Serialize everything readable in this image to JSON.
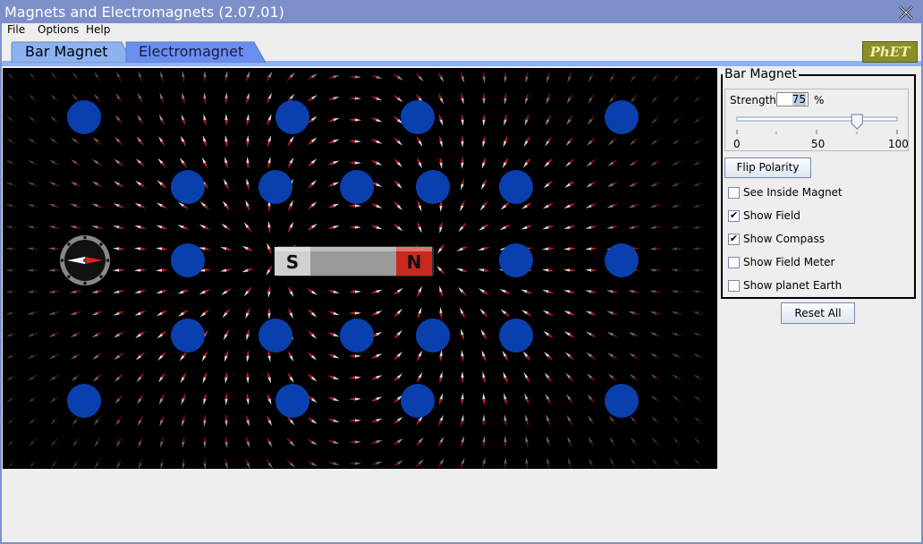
{
  "window": {
    "title": "Magnets and Electromagnets (2.07.01)"
  },
  "menu": {
    "file": "File",
    "options": "Options",
    "help": "Help"
  },
  "tabs": [
    {
      "label": "Bar Magnet",
      "selected": true
    },
    {
      "label": "Electromagnet",
      "selected": false
    }
  ],
  "logo": {
    "text": "PhET"
  },
  "magnet": {
    "south_label": "S",
    "north_label": "N"
  },
  "controls": {
    "panel_title": "Bar Magnet",
    "strength": {
      "label": "Strength:",
      "value": "75",
      "unit": "%",
      "slider_value": 75,
      "min_label": "0",
      "mid_label": "50",
      "max_label": "100"
    },
    "flip_polarity": "Flip Polarity",
    "checkboxes": [
      {
        "label": "See Inside Magnet",
        "checked": false
      },
      {
        "label": "Show Field",
        "checked": true
      },
      {
        "label": "Show Compass",
        "checked": true
      },
      {
        "label": "Show Field Meter",
        "checked": false
      },
      {
        "label": "Show planet Earth",
        "checked": false
      }
    ],
    "reset_all": "Reset All"
  },
  "colors": {
    "title_bar": "#7d8fc9",
    "tab_selected": "#8db2f0",
    "tab_unselected": "#6b8ff0",
    "blue_dot": "#0a3fae",
    "canvas_bg": "#000000",
    "magnet_north": "#c8281e",
    "magnet_south": "#d0d0d0"
  }
}
